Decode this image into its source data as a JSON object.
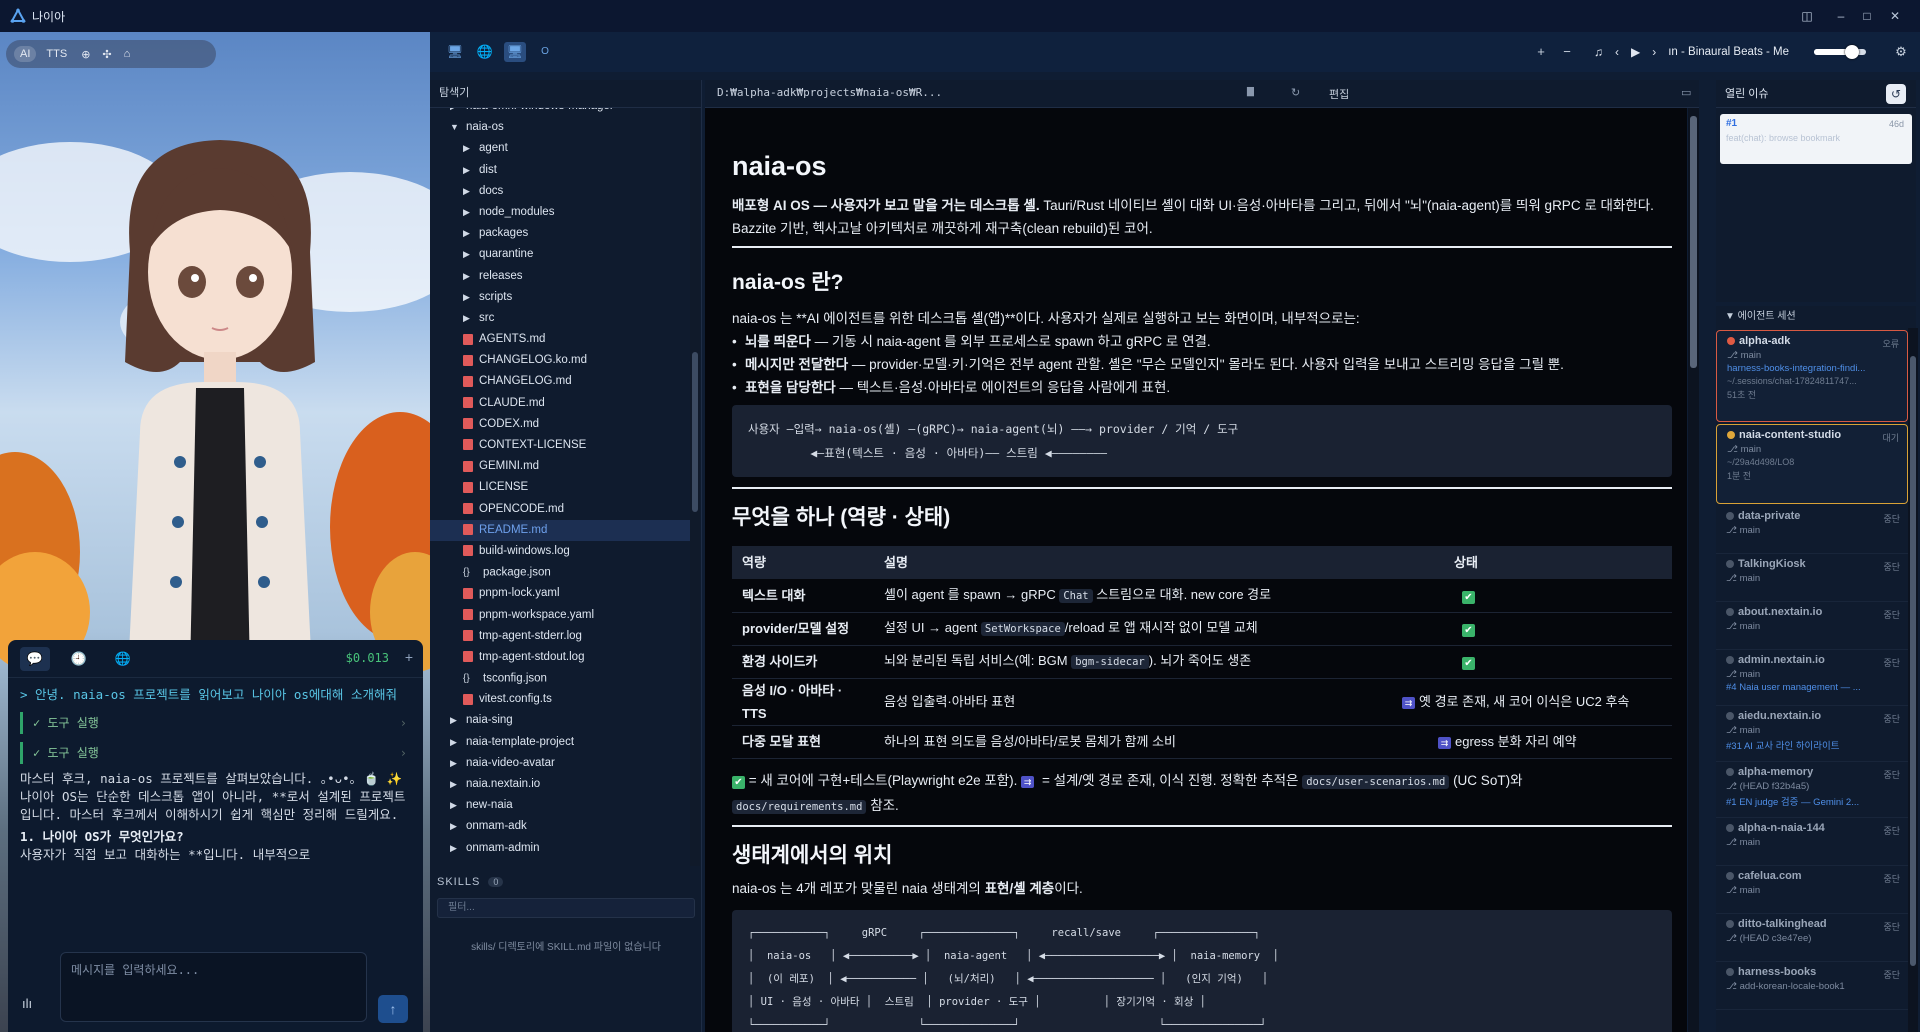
{
  "window": {
    "title": "나이아",
    "btn_panel": "◫",
    "btn_min": "–",
    "btn_max": "□",
    "btn_close": "✕"
  },
  "avatar_panel": {
    "mode_ai": "AI",
    "mode_tts": "TTS",
    "mode_icons": [
      "⊕",
      "✣",
      "⌂"
    ]
  },
  "chat": {
    "cost": "$0.013",
    "plus": "+",
    "tabs": [
      "💬",
      "🕘",
      "🌐"
    ],
    "user_message": "> 안녕. naia-os 프로젝트를 읽어보고 나이아 os에대해 소개해줘",
    "tool_runs": [
      "✓ 도구 실행",
      "✓ 도구 실행"
    ],
    "reply_1": "마스터 후크, naia-os 프로젝트를 살펴보았습니다. ｡•ᴗ•｡ 🍵 ✨",
    "reply_2": "나이아 OS는 단순한 데스크톱 앱이 아니라, **로서 설계된 프로젝트입니다. 마스터 후크께서 이해하시기 쉽게 핵심만 정리해 드릴게요.",
    "reply_heading": "1. 나이아 OS가 무엇인가요?",
    "reply_3": "사용자가 직접 보고 대화하는 **입니다. 내부적으로",
    "input_placeholder": "메시지를 입력하세요...",
    "send": "↑",
    "mic": "ılı"
  },
  "toolbar": {
    "icons": [
      "🖥",
      "🌐",
      "🖥",
      "O"
    ],
    "zoom_in": "+",
    "zoom_out": "−",
    "music_icon": "♫",
    "prev": "‹",
    "play": "▶",
    "next": "›",
    "track": "ın - Binaural Beats - Me",
    "volume": 0.72,
    "settings": "⚙"
  },
  "explorer": {
    "title": "탐색기",
    "items": [
      {
        "name": "naia-omni-windows-manager",
        "kind": "folder",
        "depth": 1,
        "open": false
      },
      {
        "name": "naia-os",
        "kind": "folder",
        "depth": 1,
        "open": true
      },
      {
        "name": "agent",
        "kind": "folder",
        "depth": 2,
        "open": false
      },
      {
        "name": "dist",
        "kind": "folder",
        "depth": 2,
        "open": false
      },
      {
        "name": "docs",
        "kind": "folder",
        "depth": 2,
        "open": false
      },
      {
        "name": "node_modules",
        "kind": "folder",
        "depth": 2,
        "open": false
      },
      {
        "name": "packages",
        "kind": "folder",
        "depth": 2,
        "open": false
      },
      {
        "name": "quarantine",
        "kind": "folder",
        "depth": 2,
        "open": false
      },
      {
        "name": "releases",
        "kind": "folder",
        "depth": 2,
        "open": false
      },
      {
        "name": "scripts",
        "kind": "folder",
        "depth": 2,
        "open": false
      },
      {
        "name": "src",
        "kind": "folder",
        "depth": 2,
        "open": false
      },
      {
        "name": "AGENTS.md",
        "kind": "md",
        "depth": 2
      },
      {
        "name": "CHANGELOG.ko.md",
        "kind": "md",
        "depth": 2
      },
      {
        "name": "CHANGELOG.md",
        "kind": "md",
        "depth": 2
      },
      {
        "name": "CLAUDE.md",
        "kind": "md",
        "depth": 2
      },
      {
        "name": "CODEX.md",
        "kind": "md",
        "depth": 2
      },
      {
        "name": "CONTEXT-LICENSE",
        "kind": "md",
        "depth": 2
      },
      {
        "name": "GEMINI.md",
        "kind": "md",
        "depth": 2
      },
      {
        "name": "LICENSE",
        "kind": "md",
        "depth": 2
      },
      {
        "name": "OPENCODE.md",
        "kind": "md",
        "depth": 2
      },
      {
        "name": "README.md",
        "kind": "md",
        "depth": 2,
        "selected": true
      },
      {
        "name": "build-windows.log",
        "kind": "md",
        "depth": 2
      },
      {
        "name": "package.json",
        "kind": "json",
        "depth": 2
      },
      {
        "name": "pnpm-lock.yaml",
        "kind": "md",
        "depth": 2
      },
      {
        "name": "pnpm-workspace.yaml",
        "kind": "md",
        "depth": 2
      },
      {
        "name": "tmp-agent-stderr.log",
        "kind": "md",
        "depth": 2
      },
      {
        "name": "tmp-agent-stdout.log",
        "kind": "md",
        "depth": 2
      },
      {
        "name": "tsconfig.json",
        "kind": "json",
        "depth": 2
      },
      {
        "name": "vitest.config.ts",
        "kind": "md",
        "depth": 2
      },
      {
        "name": "naia-sing",
        "kind": "folder",
        "depth": 1,
        "open": false
      },
      {
        "name": "naia-template-project",
        "kind": "folder",
        "depth": 1,
        "open": false
      },
      {
        "name": "naia-video-avatar",
        "kind": "folder",
        "depth": 1,
        "open": false
      },
      {
        "name": "naia.nextain.io",
        "kind": "folder",
        "depth": 1,
        "open": false
      },
      {
        "name": "new-naia",
        "kind": "folder",
        "depth": 1,
        "open": false
      },
      {
        "name": "onmam-adk",
        "kind": "folder",
        "depth": 1,
        "open": false
      },
      {
        "name": "onmam-admin",
        "kind": "folder",
        "depth": 1,
        "open": false
      }
    ],
    "skills_title": "SKILLS",
    "skills_count": "0",
    "skills_filter": "필터...",
    "skills_empty": "skills/ 디렉토리에 SKILL.md 파일이 없습니다"
  },
  "doc_header": {
    "path": "D:₩alpha-adk₩projects₩naia-os₩R...",
    "edit": "편집",
    "copy_icon": "▇",
    "refresh_icon": "↻",
    "collapse_icon": "▭"
  },
  "doc": {
    "title": "naia-os",
    "intro_bold": "배포형 AI OS — 사용자가 보고 말을 거는 데스크톱 셸.",
    "intro_rest": " Tauri/Rust 네이티브 셸이 대화 UI·음성·아바타를 그리고, 뒤에서 \"뇌\"(naia-agent)를 띄워 gRPC 로 대화한다. Bazzite 기반, 헥사고날 아키텍처로 깨끗하게 재구축(clean rebuild)된 코어.",
    "h2_what": "naia-os 란?",
    "what_para": "naia-os 는 **AI 에이전트를 위한 데스크톱 셸(앱)**이다. 사용자가 실제로 실행하고 보는 화면이며, 내부적으로는:",
    "bullets": [
      {
        "b": "뇌를 띄운다",
        "t": " — 기동 시 naia-agent 를 외부 프로세스로 spawn 하고 gRPC 로 연결."
      },
      {
        "b": "메시지만 전달한다",
        "t": " — provider·모델·키·기억은 전부 agent 관할. 셸은 \"무슨 모델인지\" 몰라도 된다. 사용자 입력을 보내고 스트리밍 응답을 그릴 뿐."
      },
      {
        "b": "표현을 담당한다",
        "t": " — 텍스트·음성·아바타로 에이전트의 응답을 사람에게 표현."
      }
    ],
    "flow": "사용자 —입력→ naia-os(셸) —(gRPC)→ naia-agent(뇌) ——→ provider / 기억 / 도구\n         ◀—표현(텍스트 · 음성 · 아바타)—— 스트림 ◀————————",
    "h2_do": "무엇을 하나 (역량 · 상태)",
    "table_head": [
      "역량",
      "설명",
      "상태"
    ],
    "table_rows": [
      {
        "cap": "텍스트 대화",
        "desc_a": "셸이 agent 를 spawn → gRPC ",
        "code": "Chat",
        "desc_b": " 스트림으로 대화. new core 경로",
        "status": "✔",
        "status_text": ""
      },
      {
        "cap": "provider/모델 설정",
        "desc_a": "설정 UI → agent ",
        "code": "SetWorkspace",
        "desc_b": "/reload 로 앱 재시작 없이 모델 교체",
        "status": "✔",
        "status_text": ""
      },
      {
        "cap": "환경 사이드카",
        "desc_a": "뇌와 분리된 독립 서비스(예: BGM ",
        "code": "bgm-sidecar",
        "desc_b": "). 뇌가 죽어도 생존",
        "status": "✔",
        "status_text": ""
      },
      {
        "cap": "음성 I/O · 아바타 · TTS",
        "desc_a": "음성 입출력·아바타 표현",
        "code": "",
        "desc_b": "",
        "status": "⇉",
        "status_text": "옛 경로 존재, 새 코어 이식은 UC2 후속"
      },
      {
        "cap": "다중 모달 표현",
        "desc_a": "하나의 표현 의도를 음성/아바타/로봇 몸체가 함께 소비",
        "code": "",
        "desc_b": "",
        "status": "⇉",
        "status_text": "egress 분화 자리 예약"
      }
    ],
    "legend_a": " = 새 코어에 구현+테스트(Playwright e2e 포함). ",
    "legend_b": " = 설계/옛 경로 존재, 이식 진행. 정확한 추적은 ",
    "legend_code1": "docs/user-scenarios.md",
    "legend_c": " (UC SoT)와",
    "legend_code2": "docs/requirements.md",
    "legend_d": " 참조.",
    "h2_eco": "생태계에서의 위치",
    "eco_para_a": "naia-os 는 4개 레포가 맞물린 naia 생태계의 ",
    "eco_para_b": "표현/셸 계층",
    "eco_para_c": "이다.",
    "eco_diagram": "┌───────────┐     gRPC     ┌──────────────┐     recall/save     ┌───────────────┐\n│  naia-os   │ ◀──────────▶ │  naia-agent   │ ◀──────────────────▶ │  naia-memory  │\n│  (이 레포)  │ ◀─────────── │   (뇌/처리)   │ ◀─────────────────── │   (인지 기억)   │\n│ UI · 음성 · 아바타 │  스트림  │ provider · 도구 │          │ 장기기억 · 회상 │\n└───────────┘              └──────────────┘                      └───────────────┘"
  },
  "issues": {
    "title": "열린 이슈",
    "refresh": "↺",
    "number": "#1",
    "age": "46d",
    "issue_title": "feat(chat): browse bookmark"
  },
  "sessions": {
    "title": "▼ 에이전트 세션",
    "items": [
      {
        "name": "alpha-adk",
        "state": "오류",
        "branch": "⎇ main",
        "link": "harness-books-integration-findi...",
        "sub": "~/.sessions/chat-17824811747...",
        "age": "51초 전",
        "style": "err"
      },
      {
        "name": "naia-content-studio",
        "state": "대기",
        "branch": "⎇ main",
        "link": "",
        "sub": "~/29a4d498/LO8",
        "age": "1분 전",
        "style": "wait"
      },
      {
        "name": "data-private",
        "state": "중단",
        "branch": "⎇ main",
        "link": "",
        "sub": "",
        "age": "",
        "style": "dim"
      },
      {
        "name": "TalkingKiosk",
        "state": "중단",
        "branch": "⎇ main",
        "link": "",
        "sub": "",
        "age": "",
        "style": "dim"
      },
      {
        "name": "about.nextain.io",
        "state": "중단",
        "branch": "⎇ main",
        "link": "",
        "sub": "",
        "age": "",
        "style": "dim"
      },
      {
        "name": "admin.nextain.io",
        "state": "중단",
        "branch": "⎇ main",
        "link": "#4 Naia user management — ...",
        "sub": "",
        "age": "",
        "style": "dim"
      },
      {
        "name": "aiedu.nextain.io",
        "state": "중단",
        "branch": "⎇ main",
        "link": "#31 AI 교사 라인 하이라이트",
        "sub": "",
        "age": "",
        "style": "dim"
      },
      {
        "name": "alpha-memory",
        "state": "중단",
        "branch": "⎇ (HEAD f32b4a5)",
        "link": "#1 EN judge 검증 — Gemini 2...",
        "sub": "",
        "age": "",
        "style": "dim"
      },
      {
        "name": "alpha-n-naia-144",
        "state": "중단",
        "branch": "⎇ main",
        "link": "",
        "sub": "",
        "age": "",
        "style": "dim"
      },
      {
        "name": "cafelua.com",
        "state": "중단",
        "branch": "⎇ main",
        "link": "",
        "sub": "",
        "age": "",
        "style": "dim"
      },
      {
        "name": "ditto-talkinghead",
        "state": "중단",
        "branch": "⎇ (HEAD c3e47ee)",
        "link": "",
        "sub": "",
        "age": "",
        "style": "dim"
      },
      {
        "name": "harness-books",
        "state": "중단",
        "branch": "⎇ add-korean-locale-book1",
        "link": "",
        "sub": "",
        "age": "",
        "style": "dim"
      }
    ]
  }
}
